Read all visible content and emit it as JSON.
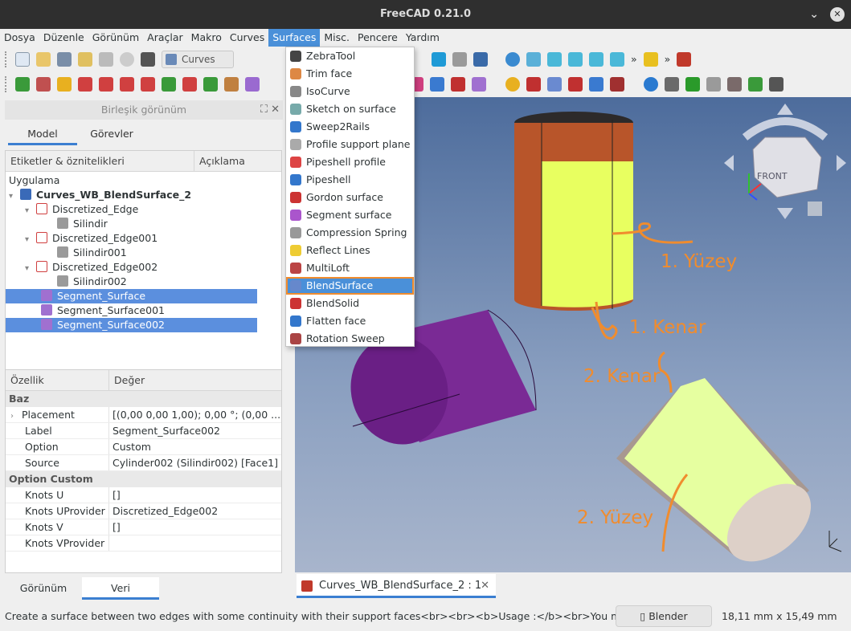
{
  "window": {
    "title": "FreeCAD 0.21.0",
    "minimize": "⌄",
    "close": "✕"
  },
  "menubar": [
    "Dosya",
    "Düzenle",
    "Görünüm",
    "Araçlar",
    "Makro",
    "Curves",
    "Surfaces",
    "Misc.",
    "Pencere",
    "Yardım"
  ],
  "toolbar": {
    "workbench": "Curves",
    "overflow": "»"
  },
  "combo": {
    "title": "Birleşik görünüm",
    "tabs": [
      "Model",
      "Görevler"
    ],
    "tree_headers": [
      "Etiketler & öznitelikleri",
      "Açıklama"
    ],
    "app_label": "Uygulama",
    "document": "Curves_WB_BlendSurface_2",
    "items": [
      {
        "label": "Discretized_Edge",
        "child": "Silindir"
      },
      {
        "label": "Discretized_Edge001",
        "child": "Silindir001"
      },
      {
        "label": "Discretized_Edge002",
        "child": "Silindir002"
      }
    ],
    "surfaces": [
      "Segment_Surface",
      "Segment_Surface001",
      "Segment_Surface002"
    ],
    "splitter": "-----"
  },
  "properties": {
    "headers": [
      "Özellik",
      "Değer"
    ],
    "group_base": "Baz",
    "base_rows": [
      {
        "name": "Placement",
        "value": "[(0,00 0,00 1,00); 0,00 °; (0,00 ..."
      },
      {
        "name": "Label",
        "value": "Segment_Surface002"
      },
      {
        "name": "Option",
        "value": "Custom"
      },
      {
        "name": "Source",
        "value": "Cylinder002 (Silindir002) [Face1]"
      }
    ],
    "group_custom": "Option Custom",
    "custom_rows": [
      {
        "name": "Knots U",
        "value": "[]"
      },
      {
        "name": "Knots UProvider",
        "value": "Discretized_Edge002"
      },
      {
        "name": "Knots V",
        "value": "[]"
      },
      {
        "name": "Knots VProvider",
        "value": ""
      }
    ]
  },
  "bottom_tabs": [
    "Görünüm",
    "Veri"
  ],
  "surfaces_menu": [
    "ZebraTool",
    "Trim face",
    "IsoCurve",
    "Sketch on surface",
    "Sweep2Rails",
    "Profile support plane",
    "Pipeshell profile",
    "Pipeshell",
    "Gordon surface",
    "Segment surface",
    "Compression Spring",
    "Reflect Lines",
    "MultiLoft",
    "BlendSurface",
    "BlendSolid",
    "Flatten face",
    "Rotation Sweep"
  ],
  "menu_icon_colors": [
    "#444",
    "#d84",
    "#888",
    "#7aa",
    "#37c",
    "#aaa",
    "#d44",
    "#37c",
    "#c33",
    "#a5c",
    "#999",
    "#ec3",
    "#b44",
    "#68c",
    "#c33",
    "#37c",
    "#a44"
  ],
  "viewport": {
    "annotations": [
      "1. Yüzey",
      "1. Kenar",
      "2. Kenar",
      "2. Yüzey"
    ],
    "navcube_face": "FRONT",
    "accent": "#f08c2e"
  },
  "doc_tab": {
    "label": "Curves_WB_BlendSurface_2 : 1",
    "close": "✕"
  },
  "status": {
    "message": "Create a surface between two edges with some continuity with their support faces<br><br><b>Usage :</b><br>You must",
    "nav_style": "Blender",
    "dimensions": "18,11 mm x 15,49 mm"
  }
}
